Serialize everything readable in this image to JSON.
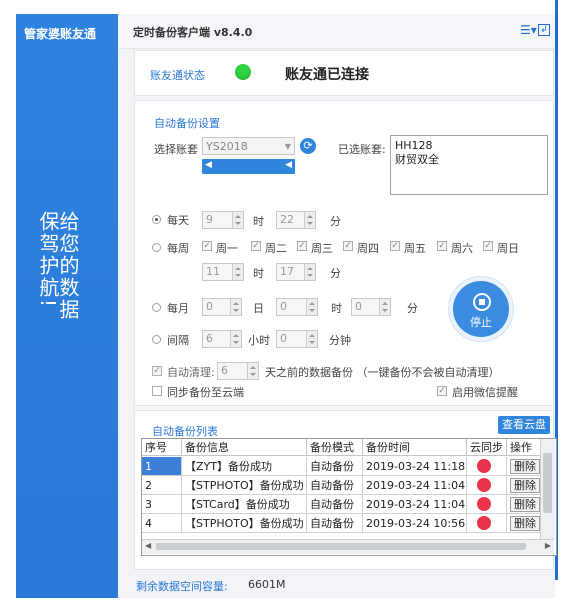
{
  "sidebar": {
    "title": "管家婆账友通",
    "slogan": "给您的数据\n保驾护航!"
  },
  "header": {
    "title": "定时备份客户端 v8.4.0",
    "menu_icon": "list-menu-icon",
    "exit_icon": "exit-icon"
  },
  "status": {
    "label": "账友通状态",
    "text": "账友通已连接",
    "color": "#2ed243"
  },
  "settings": {
    "title": "自动备份设置",
    "account_label": "选择账套",
    "account_value": "YS2018",
    "selected_label": "已选账套:",
    "selected_accounts": [
      "HH128",
      "财贸双全"
    ],
    "daily": {
      "label": "每天",
      "hour": "9",
      "hour_unit": "时",
      "minute": "22",
      "minute_unit": "分",
      "selected": true
    },
    "weekly": {
      "label": "每周",
      "days": [
        "周一",
        "周二",
        "周三",
        "周四",
        "周五",
        "周六",
        "周日"
      ],
      "hour": "11",
      "hour_unit": "时",
      "minute": "17",
      "minute_unit": "分"
    },
    "monthly": {
      "label": "每月",
      "day": "0",
      "day_unit": "日",
      "hour": "0",
      "hour_unit": "时",
      "minute": "0",
      "minute_unit": "分"
    },
    "interval": {
      "label": "间隔",
      "hours": "6",
      "hours_unit": "小时",
      "minutes": "0",
      "minutes_unit": "分钟"
    },
    "auto_clean": {
      "label": "自动清理:",
      "days": "6",
      "suffix": "天之前的数据备份 （一键备份不会被自动清理）"
    },
    "sync_cloud": "同步备份至云端",
    "wechat": "启用微信提醒",
    "stop": "停止"
  },
  "backup_list": {
    "title": "自动备份列表",
    "view_cloud": "查看云盘",
    "columns": [
      "序号",
      "备份信息",
      "备份模式",
      "备份时间",
      "云同步",
      "操作"
    ],
    "rows": [
      {
        "no": "1",
        "info": "【ZYT】备份成功",
        "mode": "自动备份",
        "time": "2019-03-24 11:18",
        "action": "删除"
      },
      {
        "no": "2",
        "info": "【STPHOTO】备份成功",
        "mode": "自动备份",
        "time": "2019-03-24 11:04",
        "action": "删除"
      },
      {
        "no": "3",
        "info": "【STCard】备份成功",
        "mode": "自动备份",
        "time": "2019-03-24 11:04",
        "action": "删除"
      },
      {
        "no": "4",
        "info": "【STPHOTO】备份成功",
        "mode": "自动备份",
        "time": "2019-03-24 10:56",
        "action": "删除"
      }
    ]
  },
  "footer": {
    "label": "剩余数据空间容量:",
    "value": "6601M"
  },
  "colors": {
    "accent": "#1e6fd0",
    "sync_red": "#e8334a"
  }
}
